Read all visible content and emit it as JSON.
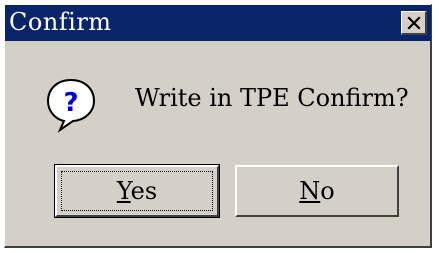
{
  "dialog": {
    "title": "Confirm",
    "message": "Write in TPE Confirm?",
    "icon": "question-icon",
    "buttons": {
      "yes": {
        "mnemonic": "Y",
        "rest": "es"
      },
      "no": {
        "mnemonic": "N",
        "rest": "o"
      }
    },
    "colors": {
      "titlebar": "#0a246a",
      "face": "#d4d0c8"
    }
  }
}
